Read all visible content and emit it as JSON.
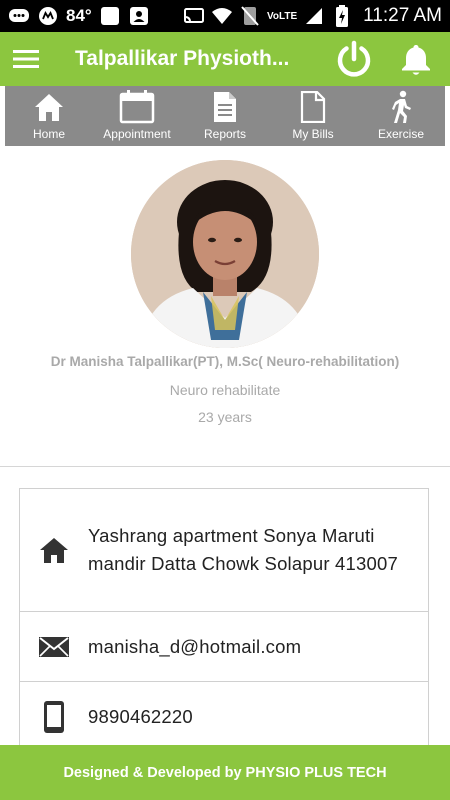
{
  "status_bar": {
    "temperature": "84°",
    "volte": "VoLTE",
    "time": "11:27 AM"
  },
  "app_bar": {
    "title": "Talpallikar Physioth...",
    "icons": [
      "menu-icon",
      "power-icon",
      "bell-icon"
    ]
  },
  "tabs": [
    {
      "label": "Home",
      "icon": "home-icon"
    },
    {
      "label": "Appointment",
      "icon": "calendar-icon"
    },
    {
      "label": "Reports",
      "icon": "report-icon"
    },
    {
      "label": "My Bills",
      "icon": "bill-icon"
    },
    {
      "label": "Exercise",
      "icon": "walking-icon"
    }
  ],
  "profile": {
    "name": "Dr Manisha Talpallikar(PT), M.Sc( Neuro-rehabilitation)",
    "specialty": "Neuro rehabilitate",
    "experience": "23 years"
  },
  "contact": {
    "address": "Yashrang apartment Sonya Maruti mandir Datta Chowk Solapur 413007",
    "email": "manisha_d@hotmail.com",
    "phone": "9890462220"
  },
  "footer": {
    "text": "Designed & Developed by PHYSIO PLUS TECH"
  },
  "colors": {
    "brand_green": "#8cc63f",
    "tab_bar_gray": "#8a8a8a",
    "muted_text": "#a9a9a9"
  }
}
